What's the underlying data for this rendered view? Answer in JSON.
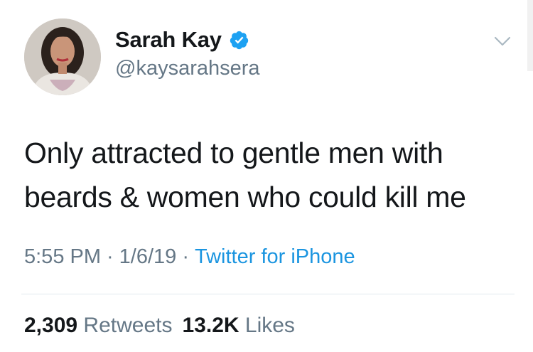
{
  "user": {
    "display_name": "Sarah Kay",
    "handle": "@kaysarahsera",
    "verified": true
  },
  "tweet": {
    "text_line1": "Only attracted to gentle men with",
    "text_line2": "beards & women who could kill me",
    "time": "5:55 PM",
    "date": "1/6/19",
    "separator": "·",
    "source": "Twitter for iPhone"
  },
  "stats": {
    "retweets_count": "2,309",
    "retweets_label": "Retweets",
    "likes_count": "13.2K",
    "likes_label": "Likes"
  },
  "colors": {
    "text": "#14171a",
    "secondary": "#657786",
    "link": "#1b95e0",
    "verified_badge": "#1da1f2",
    "divider": "#e1e8ed"
  },
  "icons": {
    "verified": "verified-badge-icon",
    "menu": "chevron-down-icon"
  }
}
